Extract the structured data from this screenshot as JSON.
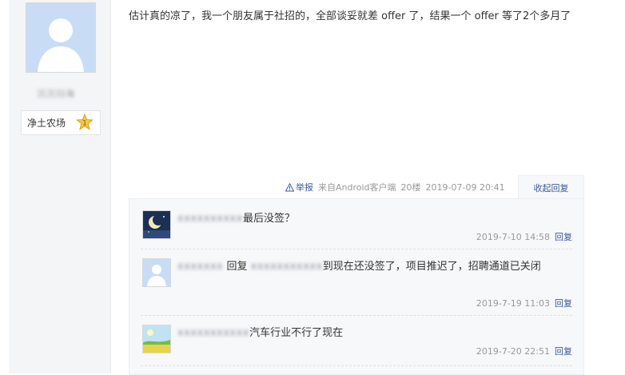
{
  "user": {
    "name": "沉沉归海",
    "level_name": "净土农场",
    "level_number": "1"
  },
  "post": {
    "content": "估计真的凉了，我一个朋友属于社招的，全部谈妥就差 offer 了，结果一个 offer 等了2个多月了",
    "report_label": "举报",
    "source": "来自Android客户端",
    "floor": "20楼",
    "timestamp": "2019-07-09 20:41",
    "collapse_label": "收起回复"
  },
  "replies": [
    {
      "author": "xxxxxxxxxx",
      "text": "最后没签？",
      "timestamp": "2019-7-10 14:58",
      "reply_label": "回复",
      "avatar": "moon-night"
    },
    {
      "author": "xxxxxxx",
      "reply_word": "回复",
      "target": "xxxxxxxxxxx",
      "text": "到现在还没签了，项目推迟了，招聘通道已关闭",
      "timestamp": "2019-7-19 11:03",
      "reply_label": "回复",
      "avatar": "default-user"
    },
    {
      "author": "xxxxxxxxxxx",
      "text": "汽车行业不行了现在",
      "timestamp": "2019-7-20 22:51",
      "reply_label": "回复",
      "avatar": "green-field"
    }
  ],
  "colors": {
    "link": "#3a5a92",
    "meta": "#999999",
    "sidebar_bg": "#f4f5f7",
    "reply_bg": "#f7f8fa"
  }
}
